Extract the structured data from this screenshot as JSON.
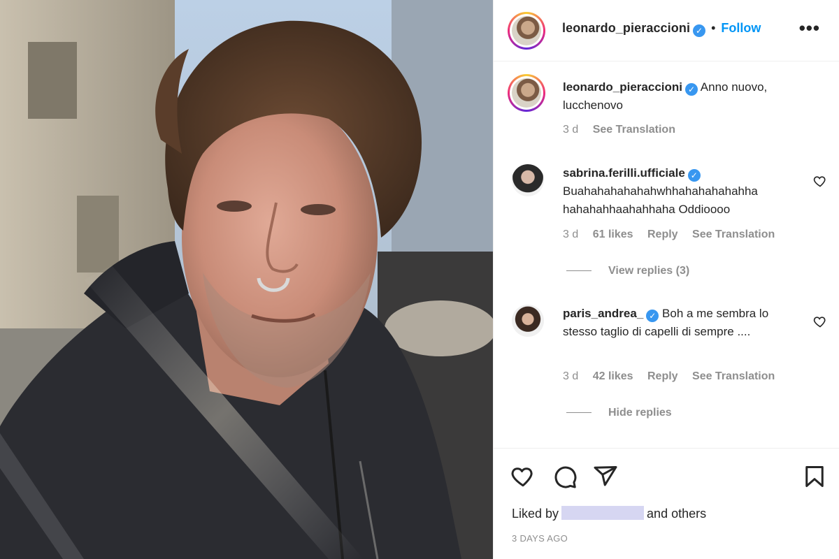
{
  "post": {
    "author": "leonardo_pieraccioni",
    "follow_label": "Follow",
    "separator": "•",
    "more_label": "•••",
    "verified_mark": "✓"
  },
  "caption": {
    "username": "leonardo_pieraccioni",
    "text": "Anno nuovo, lucchenovo",
    "time": "3 d",
    "see_translation": "See Translation"
  },
  "comments": [
    {
      "username": "sabrina.ferilli.ufficiale",
      "text": "Buahahahahahahwhhahahahahahha hahahahhaahahhaha Oddioooo",
      "time": "3 d",
      "likes": "61 likes",
      "reply": "Reply",
      "see_translation": "See Translation",
      "replies_toggle": "View replies (3)"
    },
    {
      "username": "paris_andrea_",
      "text": "Boh a me sembra lo stesso taglio di capelli di sempre ....",
      "time": "3 d",
      "likes": "42 likes",
      "reply": "Reply",
      "see_translation": "See Translation",
      "replies_toggle": "Hide replies"
    }
  ],
  "likes": {
    "prefix": "Liked by",
    "suffix": "and others"
  },
  "timestamp": "3 DAYS AGO",
  "icons": {
    "like": "heart-icon",
    "comment": "comment-icon",
    "share": "paper-plane-icon",
    "save": "bookmark-icon"
  },
  "colors": {
    "link_blue": "#0095f6",
    "verified_blue": "#3897f0",
    "muted_text": "#8e8e8e",
    "text": "#262626"
  }
}
